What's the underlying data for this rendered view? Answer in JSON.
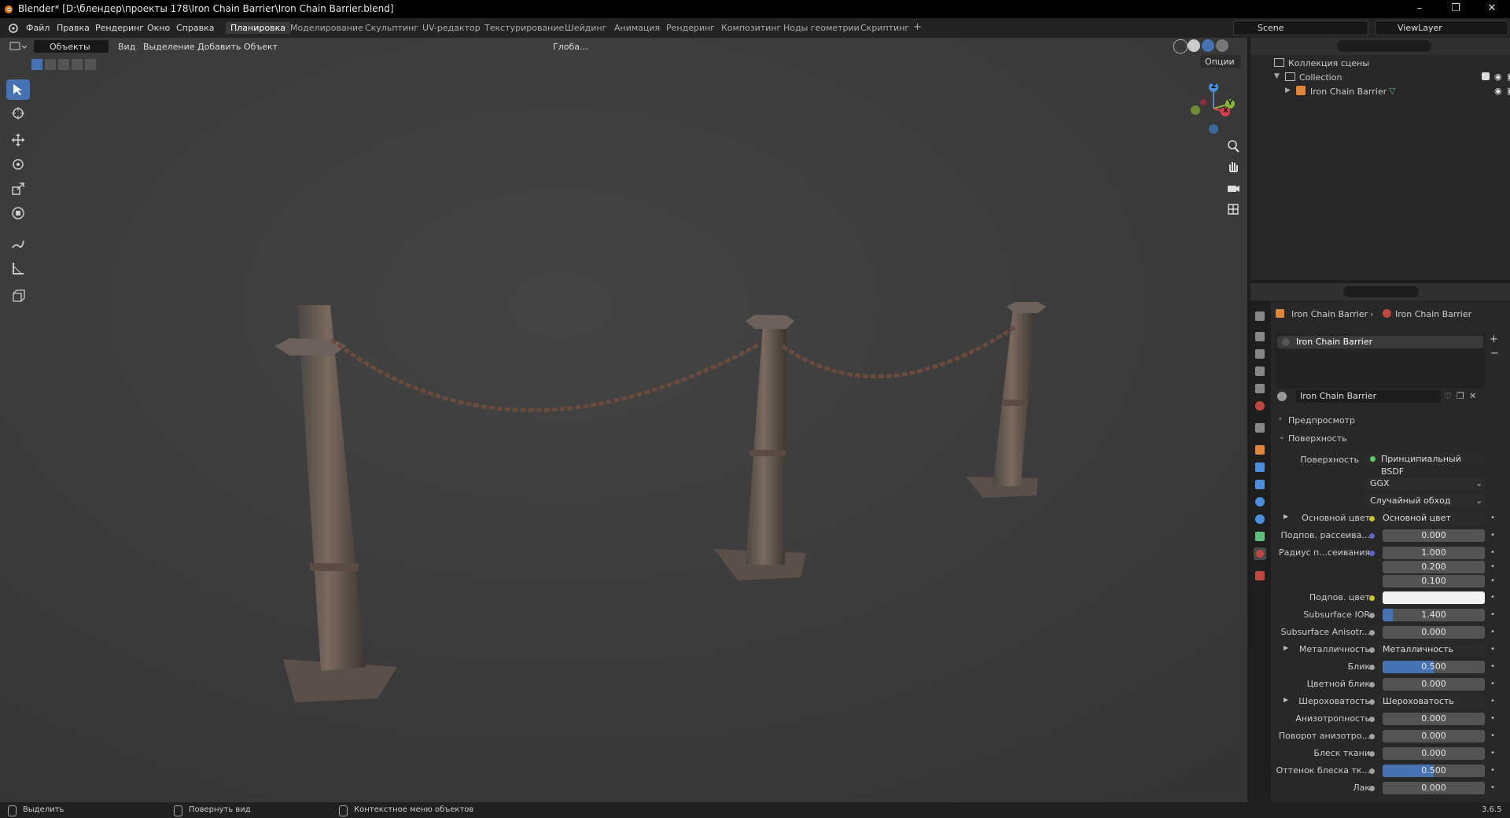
{
  "titlebar": {
    "title": "Blender* [D:\\блендер\\проекты 178\\Iron Chain Barrier\\Iron Chain Barrier.blend]",
    "minimize": "–",
    "maximize": "❐",
    "close": "✕"
  },
  "menubar": {
    "menus": [
      "Файл",
      "Правка",
      "Рендеринг",
      "Окно",
      "Справка"
    ],
    "workspaces": [
      "Планировка",
      "Моделирование",
      "Скульптинг",
      "UV-редактор",
      "Текстурирование",
      "Шейдинг",
      "Анимация",
      "Рендеринг",
      "Композитинг",
      "Ноды геометрии",
      "Скриптинг"
    ],
    "active_workspace": "Планировка",
    "add_tab": "+",
    "scene": "Scene",
    "view_layer": "ViewLayer"
  },
  "viewport_header": {
    "mode": "Объекты",
    "menus": [
      "Вид",
      "Выделение",
      "Добавить",
      "Объект"
    ],
    "orientation": "Глоба...",
    "options": "Опции"
  },
  "gizmo": {
    "z": "Z",
    "y": "Y",
    "x": "X"
  },
  "outliner": {
    "scene_collection": "Коллекция сцены",
    "collection": "Collection",
    "object": "Iron Chain Barrier"
  },
  "properties": {
    "breadcrumb_object": "Iron Chain Barrier",
    "breadcrumb_material": "Iron Chain Barrier",
    "material_slot": "Iron Chain Barrier",
    "material_name": "Iron Chain Barrier",
    "panels": {
      "preview": "Предпросмотр",
      "surface": "Поверхность"
    },
    "surface_label": "Поверхность",
    "surface_shader": "Принципиальный BSDF",
    "distribution": "GGX",
    "subsurface_method": "Случайный обход",
    "rows": [
      {
        "label": "Основной цвет",
        "kind": "link",
        "value": "Основной цвет",
        "socket": "#c7c729",
        "expand": true
      },
      {
        "label": "Подпов. рассеива...",
        "kind": "num",
        "value": "0.000",
        "socket": "#6363c7",
        "fill": 0
      },
      {
        "label": "Радиус п...сеивания",
        "kind": "num",
        "value": "1.000",
        "socket": "#6363c7",
        "fill": 0
      },
      {
        "label": "",
        "kind": "num",
        "value": "0.200",
        "socket": "",
        "fill": 0
      },
      {
        "label": "",
        "kind": "num",
        "value": "0.100",
        "socket": "",
        "fill": 0
      },
      {
        "label": "Подпов. цвет",
        "kind": "color",
        "value": "",
        "socket": "#c7c729",
        "color": "#f2f2f2"
      },
      {
        "label": "Subsurface IOR",
        "kind": "num",
        "value": "1.400",
        "socket": "#a1a1a1",
        "fill": 0.1
      },
      {
        "label": "Subsurface Anisotr...",
        "kind": "num",
        "value": "0.000",
        "socket": "#a1a1a1",
        "fill": 0
      },
      {
        "label": "Металличность",
        "kind": "link",
        "value": "Металличность",
        "socket": "#a1a1a1",
        "expand": true
      },
      {
        "label": "Блик",
        "kind": "num",
        "value": "0.500",
        "socket": "#a1a1a1",
        "fill": 0.5
      },
      {
        "label": "Цветной блик",
        "kind": "num",
        "value": "0.000",
        "socket": "#a1a1a1",
        "fill": 0
      },
      {
        "label": "Шероховатость",
        "kind": "link",
        "value": "Шероховатость",
        "socket": "#a1a1a1",
        "expand": true
      },
      {
        "label": "Анизотропность",
        "kind": "num",
        "value": "0.000",
        "socket": "#a1a1a1",
        "fill": 0
      },
      {
        "label": "Поворот анизотро...",
        "kind": "num",
        "value": "0.000",
        "socket": "#a1a1a1",
        "fill": 0
      },
      {
        "label": "Блеск ткани",
        "kind": "num",
        "value": "0.000",
        "socket": "#a1a1a1",
        "fill": 0
      },
      {
        "label": "Оттенок блеска тк...",
        "kind": "num",
        "value": "0.500",
        "socket": "#a1a1a1",
        "fill": 0.5
      },
      {
        "label": "Лак",
        "kind": "num",
        "value": "0.000",
        "socket": "#a1a1a1",
        "fill": 0
      }
    ]
  },
  "statusbar": {
    "select": "Выделить",
    "rotate": "Повернуть вид",
    "context": "Контекстное меню объектов",
    "version": "3.6.5"
  },
  "colors": {
    "accent": "#4772b3",
    "viewport_bg": "#3d3d3d",
    "panel_bg": "#282828"
  }
}
